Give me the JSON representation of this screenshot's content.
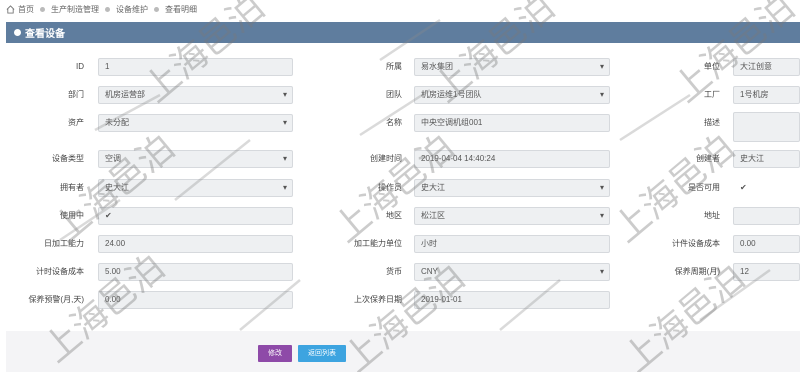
{
  "breadcrumb": {
    "items": [
      "首页",
      "生产制造管理",
      "设备维护",
      "查看明细"
    ]
  },
  "panel": {
    "title": "查看设备"
  },
  "fields": {
    "id": {
      "label": "ID",
      "value": "1"
    },
    "dept": {
      "label": "部门",
      "value": "机房运营部"
    },
    "asset": {
      "label": "资产",
      "value": "未分配"
    },
    "equip_type": {
      "label": "设备类型",
      "value": "空调"
    },
    "owner": {
      "label": "拥有者",
      "value": "史大江"
    },
    "in_use": {
      "label": "使用中",
      "checked": true
    },
    "daily_capacity": {
      "label": "日加工能力",
      "value": "24.00"
    },
    "timed_cost": {
      "label": "计时设备成本",
      "value": "5.00"
    },
    "maint_warn": {
      "label": "保养预警(月,天)",
      "value": "0.00"
    },
    "group": {
      "label": "所属",
      "value": "易水集团"
    },
    "team": {
      "label": "团队",
      "value": "机房运维1号团队"
    },
    "name": {
      "label": "名称",
      "value": "中央空调机组001"
    },
    "created_at": {
      "label": "创建时间",
      "value": "2019-04-04 14:40:24"
    },
    "operator": {
      "label": "操作员",
      "value": "史大江"
    },
    "region": {
      "label": "地区",
      "value": "松江区"
    },
    "capacity_unit": {
      "label": "加工能力单位",
      "value": "小时"
    },
    "currency": {
      "label": "货币",
      "value": "CNY"
    },
    "last_maint": {
      "label": "上次保养日期",
      "value": "2019-01-01"
    },
    "unit": {
      "label": "单位",
      "value": "大江创意"
    },
    "factory": {
      "label": "工厂",
      "value": "1号机房"
    },
    "desc": {
      "label": "描述",
      "value": ""
    },
    "creator": {
      "label": "创建者",
      "value": "史大江"
    },
    "available": {
      "label": "是否可用",
      "checked": true
    },
    "address": {
      "label": "地址",
      "value": ""
    },
    "piece_cost": {
      "label": "计件设备成本",
      "value": "0.00"
    },
    "maint_cycle": {
      "label": "保养周期(月)",
      "value": "12"
    }
  },
  "buttons": {
    "edit": "修改",
    "back": "返回列表"
  },
  "watermark": {
    "text": "上海邑泊"
  },
  "colors": {
    "header": "#5f7d9e",
    "edit": "#8e4aa8",
    "back": "#3da4e0"
  }
}
